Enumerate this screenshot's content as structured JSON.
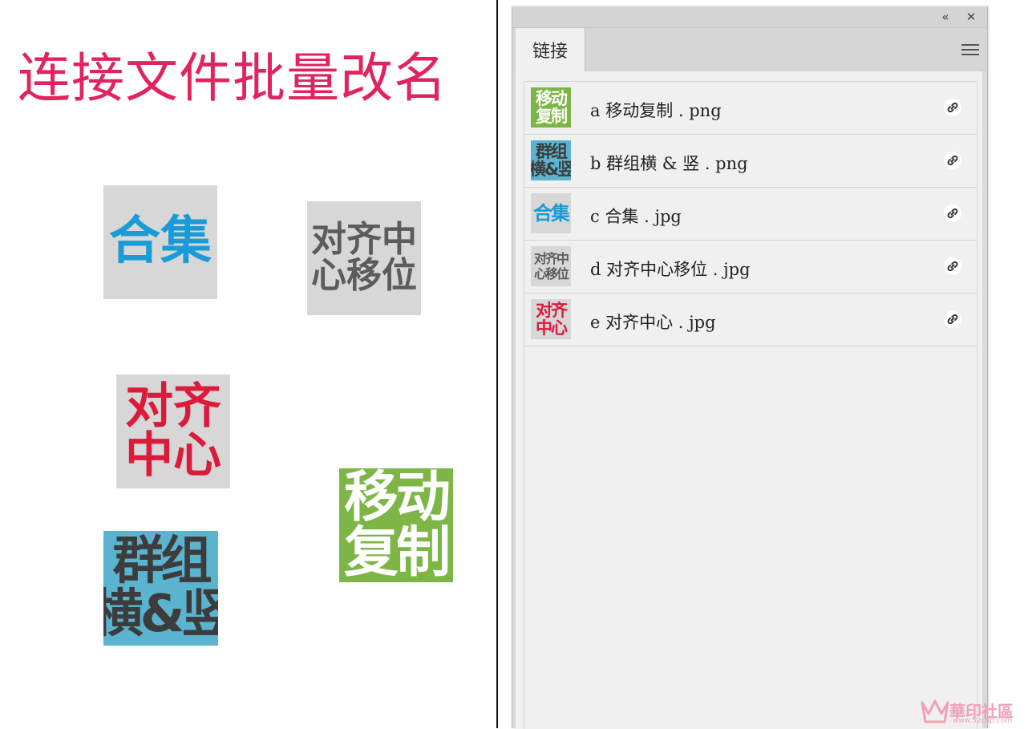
{
  "canvas": {
    "title": "连接文件批量改名",
    "title_color": "#e0245e",
    "tiles": [
      {
        "lines": [
          "合集"
        ],
        "fg": "#1a9bd7",
        "bg": "#d7d7d7"
      },
      {
        "lines": [
          "对齐中",
          "心移位"
        ],
        "fg": "#5c5c5c",
        "bg": "#d7d7d7"
      },
      {
        "lines": [
          "对齐",
          "中心"
        ],
        "fg": "#dc1a3c",
        "bg": "#d7d7d7"
      },
      {
        "lines": [
          "移动",
          "复制"
        ],
        "fg": "#ffffff",
        "bg": "#7db647"
      },
      {
        "lines": [
          "群组",
          "横&竖"
        ],
        "fg": "#3c3c3c",
        "bg": "#5ab3cf"
      }
    ]
  },
  "panel": {
    "tab_label": "链接",
    "collapse_icon": "«",
    "close_icon": "✕",
    "menu_icon": "hamburger-menu-icon",
    "links": [
      {
        "name": "a 移动复制 . png",
        "thumb_lines": [
          "移动",
          "复制"
        ],
        "fg": "#ffffff",
        "bg": "#7db647"
      },
      {
        "name": "b 群组横 & 竖 . png",
        "thumb_lines": [
          "群组",
          "横&竖"
        ],
        "fg": "#3c3c3c",
        "bg": "#5ab3cf"
      },
      {
        "name": "c 合集 . jpg",
        "thumb_lines": [
          "合集"
        ],
        "fg": "#1a9bd7",
        "bg": "#d7d7d7"
      },
      {
        "name": "d 对齐中心移位 . jpg",
        "thumb_lines": [
          "对齐中",
          "心移位"
        ],
        "fg": "#5c5c5c",
        "bg": "#d7d7d7"
      },
      {
        "name": "e 对齐中心 . jpg",
        "thumb_lines": [
          "对齐",
          "中心"
        ],
        "fg": "#dc1a3c",
        "bg": "#d7d7d7"
      }
    ]
  },
  "watermark": {
    "text": "華印社區",
    "url": "www.52cnp.com"
  }
}
